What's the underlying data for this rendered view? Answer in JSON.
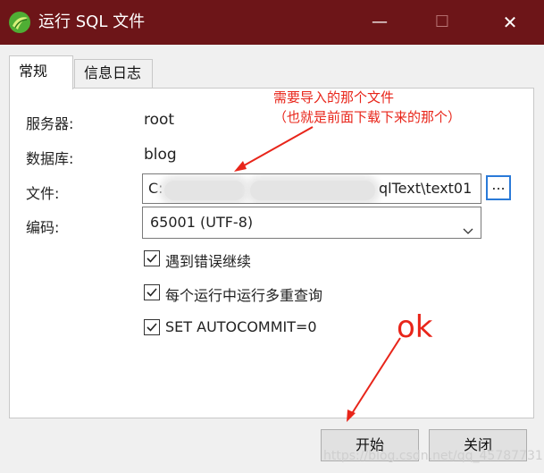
{
  "window": {
    "title": "运行 SQL 文件",
    "controls": {
      "minimize": "—",
      "maximize": "☐",
      "close": "✕"
    }
  },
  "tabs": [
    {
      "label": "常规",
      "active": true
    },
    {
      "label": "信息日志",
      "active": false
    }
  ],
  "form": {
    "server_label": "服务器:",
    "server_value": "root",
    "database_label": "数据库:",
    "database_value": "blog",
    "file_label": "文件:",
    "file_value_prefix": "C:",
    "file_value_suffix": "qlText\\text01",
    "browse_label": "...",
    "encoding_label": "编码:",
    "encoding_value": "65001 (UTF-8)",
    "options": [
      {
        "label": "遇到错误继续",
        "checked": true
      },
      {
        "label": "每个运行中运行多重查询",
        "checked": true
      },
      {
        "label": "SET AUTOCOMMIT=0",
        "checked": true
      }
    ]
  },
  "buttons": {
    "start": "开始",
    "close": "关闭"
  },
  "annotations": {
    "line1": "需要导入的那个文件",
    "line2": "（也就是前面下载下来的那个）",
    "ok": "ok"
  },
  "watermark": "https://blog.csdn.net/qq_45787731",
  "colors": {
    "titlebar": "#6d1518",
    "annotation": "#e8251a",
    "browse_border": "#2a7ad8"
  }
}
